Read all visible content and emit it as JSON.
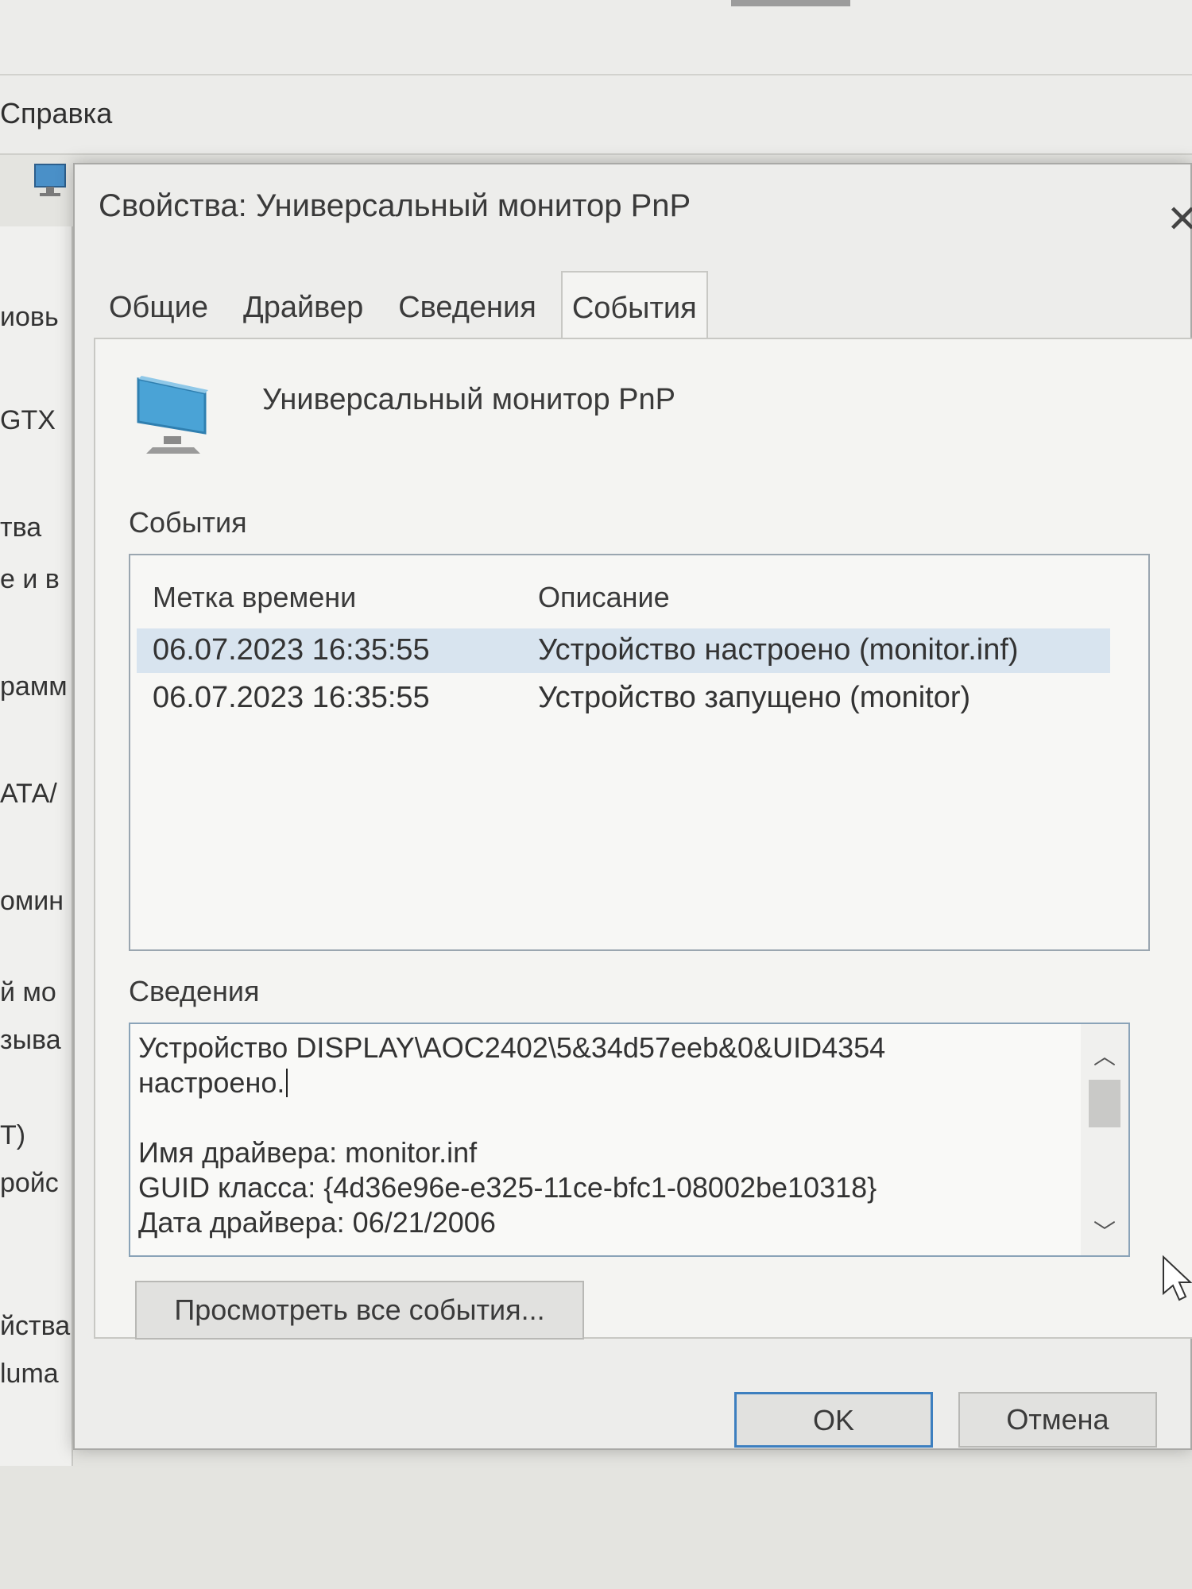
{
  "background": {
    "menu": "Справка",
    "tree_items": [
      "иовь",
      "GTX",
      "тва",
      "е и в",
      "рамм",
      "АТА/",
      "омин",
      "й мо",
      "зыва",
      "Т)",
      "ройс",
      "йства",
      "luma"
    ]
  },
  "dialog": {
    "title": "Свойства: Универсальный монитор PnP",
    "close_glyph": "✕",
    "tabs": [
      {
        "label": "Общие",
        "active": false
      },
      {
        "label": "Драйвер",
        "active": false
      },
      {
        "label": "Сведения",
        "active": false
      },
      {
        "label": "События",
        "active": true
      }
    ],
    "device_name": "Универсальный монитор PnP",
    "events_label": "События",
    "events_table": {
      "columns": [
        "Метка времени",
        "Описание"
      ],
      "rows": [
        {
          "time": "06.07.2023 16:35:55",
          "description": "Устройство настроено (monitor.inf)",
          "selected": true
        },
        {
          "time": "06.07.2023 16:35:55",
          "description": "Устройство запущено (monitor)",
          "selected": false
        }
      ]
    },
    "details_label": "Сведения",
    "details_lines": [
      "Устройство DISPLAY\\AOC2402\\5&34d57eeb&0&UID4354",
      "настроено.",
      "",
      "Имя драйвера: monitor.inf",
      "GUID класса: {4d36e96e-e325-11ce-bfc1-08002be10318}",
      "Дата драйвера: 06/21/2006"
    ],
    "view_all_button": "Просмотреть все события...",
    "ok_button": "OK",
    "cancel_button": "Отмена"
  },
  "colors": {
    "selected_row": "#d8e4ef",
    "focus_border": "#3d7fbf",
    "icon_blue": "#4aa3d6"
  }
}
